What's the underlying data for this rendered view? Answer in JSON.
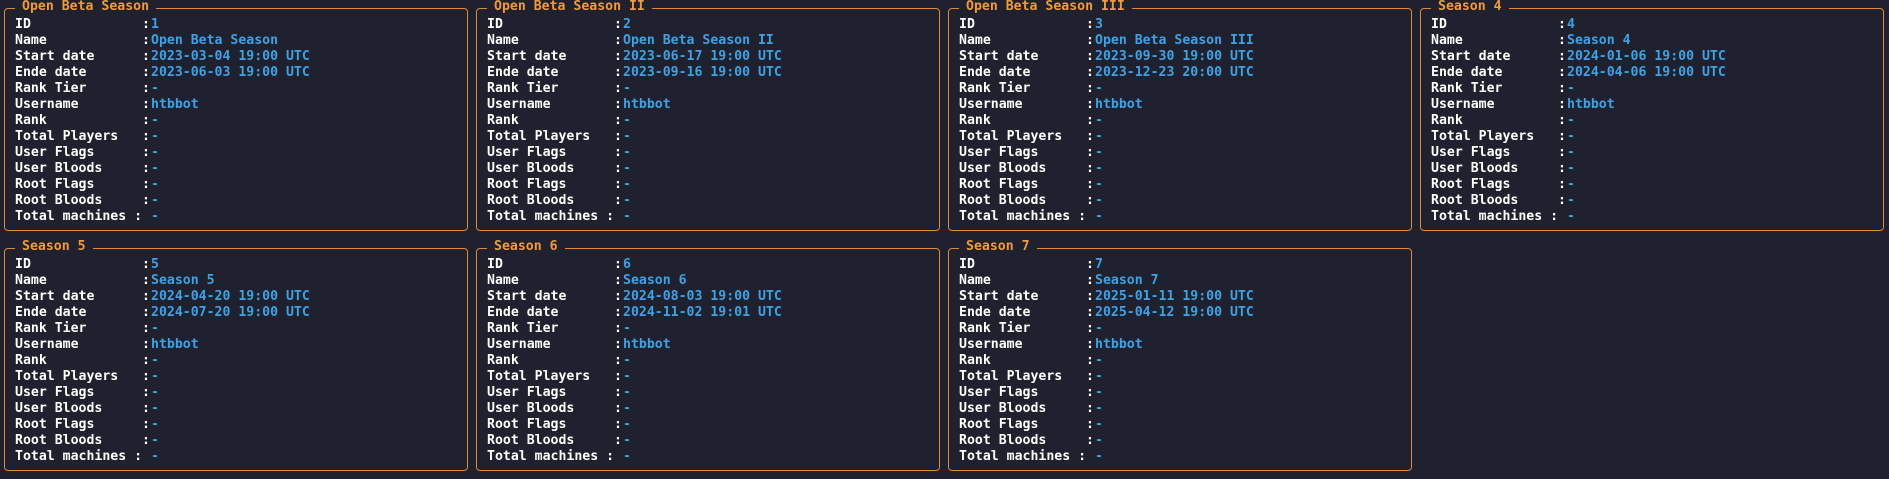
{
  "field_labels": {
    "id": "ID              :",
    "name": "Name            :",
    "start": "Start date      :",
    "end": "Ende date       :",
    "rank_tier": "Rank Tier       :",
    "username": "Username        :",
    "rank": "Rank            :",
    "total_players": "Total Players   :",
    "user_flags": "User Flags      :",
    "user_bloods": "User Bloods     :",
    "root_flags": "Root Flags      :",
    "root_bloods": "Root Bloods     :",
    "total_machines": "Total machines :"
  },
  "seasons": [
    {
      "title": "Open Beta Season",
      "id": "1",
      "name": "Open Beta Season",
      "start": "2023-03-04 19:00 UTC",
      "end": "2023-06-03 19:00 UTC",
      "rank_tier": "-",
      "username": "htbbot",
      "rank": "-",
      "total_players": "-",
      "user_flags": "-",
      "user_bloods": "-",
      "root_flags": "-",
      "root_bloods": "-",
      "total_machines": "-"
    },
    {
      "title": "Open Beta Season II",
      "id": "2",
      "name": "Open Beta Season II",
      "start": "2023-06-17 19:00 UTC",
      "end": "2023-09-16 19:00 UTC",
      "rank_tier": "-",
      "username": "htbbot",
      "rank": "-",
      "total_players": "-",
      "user_flags": "-",
      "user_bloods": "-",
      "root_flags": "-",
      "root_bloods": "-",
      "total_machines": "-"
    },
    {
      "title": "Open Beta Season III",
      "id": "3",
      "name": "Open Beta Season III",
      "start": "2023-09-30 19:00 UTC",
      "end": "2023-12-23 20:00 UTC",
      "rank_tier": "-",
      "username": "htbbot",
      "rank": "-",
      "total_players": "-",
      "user_flags": "-",
      "user_bloods": "-",
      "root_flags": "-",
      "root_bloods": "-",
      "total_machines": "-"
    },
    {
      "title": "Season 4",
      "id": "4",
      "name": "Season 4",
      "start": "2024-01-06 19:00 UTC",
      "end": "2024-04-06 19:00 UTC",
      "rank_tier": "-",
      "username": "htbbot",
      "rank": "-",
      "total_players": "-",
      "user_flags": "-",
      "user_bloods": "-",
      "root_flags": "-",
      "root_bloods": "-",
      "total_machines": "-"
    },
    {
      "title": "Season 5",
      "id": "5",
      "name": "Season 5",
      "start": "2024-04-20 19:00 UTC",
      "end": "2024-07-20 19:00 UTC",
      "rank_tier": "-",
      "username": "htbbot",
      "rank": "-",
      "total_players": "-",
      "user_flags": "-",
      "user_bloods": "-",
      "root_flags": "-",
      "root_bloods": "-",
      "total_machines": "-"
    },
    {
      "title": "Season 6",
      "id": "6",
      "name": "Season 6",
      "start": "2024-08-03 19:00 UTC",
      "end": "2024-11-02 19:01 UTC",
      "rank_tier": "-",
      "username": "htbbot",
      "rank": "-",
      "total_players": "-",
      "user_flags": "-",
      "user_bloods": "-",
      "root_flags": "-",
      "root_bloods": "-",
      "total_machines": "-"
    },
    {
      "title": "Season 7",
      "id": "7",
      "name": "Season 7",
      "start": "2025-01-11 19:00 UTC",
      "end": "2025-04-12 19:00 UTC",
      "rank_tier": "-",
      "username": "htbbot",
      "rank": "-",
      "total_players": "-",
      "user_flags": "-",
      "user_bloods": "-",
      "root_flags": "-",
      "root_bloods": "-",
      "total_machines": "-"
    }
  ],
  "colors": {
    "background": "#1f222e",
    "border": "#e08a3a",
    "title": "#f39a3a",
    "label": "#ffffff",
    "value": "#3aa3ea"
  }
}
